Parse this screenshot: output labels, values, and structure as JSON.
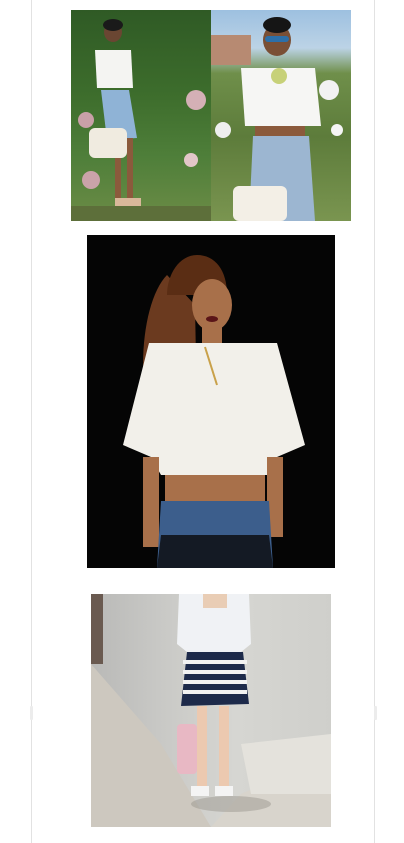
{
  "photos": [
    {
      "subject": "woman-white-crop-top-denim-skirt-garden"
    },
    {
      "subject": "woman-white-crop-top-denim-black-background"
    },
    {
      "subject": "woman-white-top-striped-skirt-street"
    }
  ],
  "colors": {
    "page_background": "#ffffff",
    "frame_border": "#e2e2e2",
    "photo2_background": "#050505"
  }
}
